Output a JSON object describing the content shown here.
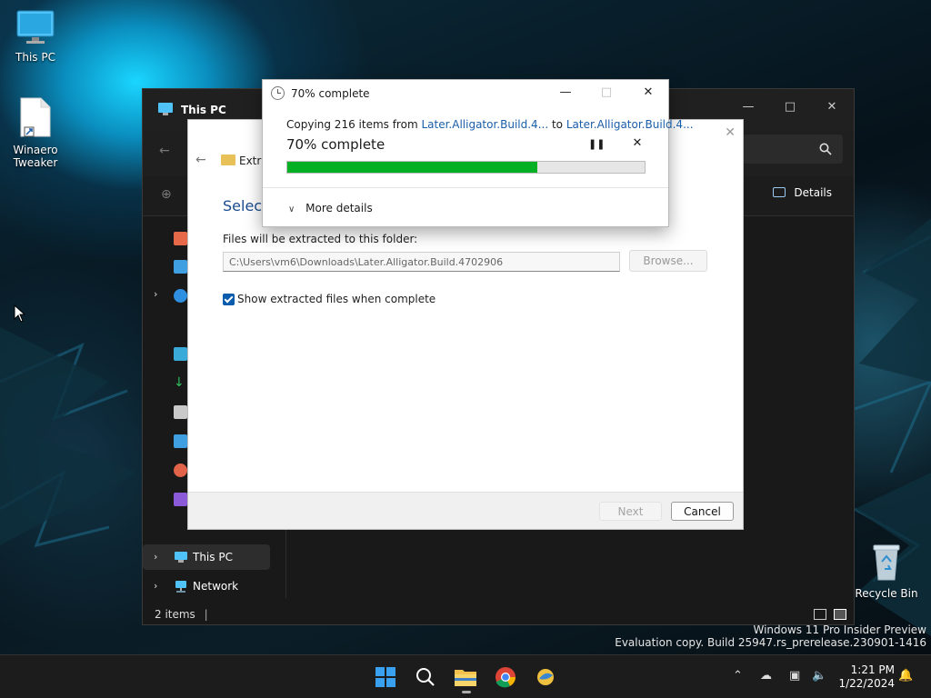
{
  "desktop": {
    "icons": [
      {
        "label": "This PC"
      },
      {
        "label": "Winaero Tweaker"
      },
      {
        "label": "Recycle Bin"
      }
    ],
    "watermark": {
      "line1": "Windows 11 Pro Insider Preview",
      "line2": "Evaluation copy. Build 25947.rs_prerelease.230901-1416"
    }
  },
  "explorer": {
    "title": "This PC",
    "details_label": "Details",
    "nav": {
      "this_pc": "This PC",
      "network": "Network"
    },
    "status": "2 items"
  },
  "wizard": {
    "path_crumb": "Extra",
    "heading": "Select",
    "folder_label": "Files will be extracted to this folder:",
    "folder_value": "C:\\Users\\vm6\\Downloads\\Later.Alligator.Build.4702906",
    "browse_label": "Browse...",
    "show_files_label": "Show extracted files when complete",
    "next_label": "Next",
    "cancel_label": "Cancel"
  },
  "progress": {
    "title": "70% complete",
    "copy_prefix": "Copying 216 items from",
    "source": "Later.Alligator.Build.4...",
    "to_word": "to",
    "destination": "Later.Alligator.Build.4...",
    "percent_text": "70% complete",
    "percent": 70,
    "more_details": "More details",
    "fill_color": "#06b025"
  },
  "taskbar": {
    "time": "1:21 PM",
    "date": "1/22/2024"
  }
}
